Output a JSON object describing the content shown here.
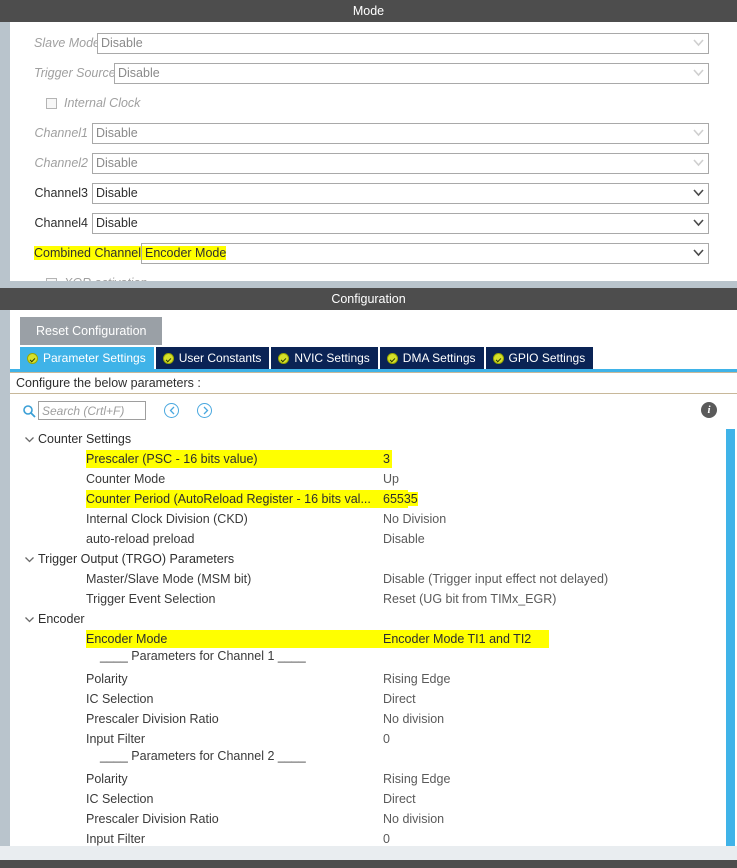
{
  "mode": {
    "title": "Mode",
    "rows": [
      {
        "label": "Slave Mode",
        "value": "Disable",
        "enabled": false,
        "highlight": false,
        "type": "combo"
      },
      {
        "label": "Trigger Source",
        "value": "Disable",
        "enabled": false,
        "highlight": false,
        "type": "combo"
      },
      {
        "label": "Internal Clock",
        "value": "",
        "enabled": false,
        "highlight": false,
        "type": "checkbox",
        "checked": false
      },
      {
        "label": "Channel1",
        "value": "Disable",
        "enabled": false,
        "highlight": false,
        "type": "combo"
      },
      {
        "label": "Channel2",
        "value": "Disable",
        "enabled": false,
        "highlight": false,
        "type": "combo"
      },
      {
        "label": "Channel3",
        "value": "Disable",
        "enabled": true,
        "highlight": false,
        "type": "combo"
      },
      {
        "label": "Channel4",
        "value": "Disable",
        "enabled": true,
        "highlight": false,
        "type": "combo"
      },
      {
        "label": "Combined Channels",
        "value": "Encoder Mode",
        "enabled": true,
        "highlight": true,
        "type": "combo"
      },
      {
        "label": "XOR activation",
        "value": "",
        "enabled": false,
        "highlight": false,
        "type": "checkbox",
        "checked": false
      }
    ]
  },
  "configuration": {
    "title": "Configuration",
    "reset_button": "Reset Configuration",
    "tabs": [
      {
        "label": "Parameter Settings",
        "active": true,
        "icon": "check-circle-icon"
      },
      {
        "label": "User Constants",
        "active": false,
        "icon": "check-circle-icon"
      },
      {
        "label": "NVIC Settings",
        "active": false,
        "icon": "check-circle-icon"
      },
      {
        "label": "DMA Settings",
        "active": false,
        "icon": "check-circle-icon"
      },
      {
        "label": "GPIO Settings",
        "active": false,
        "icon": "check-circle-icon"
      }
    ],
    "configure_note": "Configure the below parameters :",
    "search": {
      "placeholder": "Search (Crtl+F)",
      "value": ""
    },
    "info_glyph": "i",
    "groups": [
      {
        "name": "Counter Settings",
        "expanded": true,
        "rows": [
          {
            "name": "Prescaler (PSC - 16 bits value)",
            "value": "3",
            "highlight": true,
            "hlwidth": "w1"
          },
          {
            "name": "Counter Mode",
            "value": "Up",
            "highlight": false,
            "hlwidth": ""
          },
          {
            "name": "Counter Period (AutoReload Register - 16 bits val...",
            "value": "65535",
            "highlight": true,
            "hlwidth": "w2"
          },
          {
            "name": "Internal Clock Division (CKD)",
            "value": "No Division",
            "highlight": false,
            "hlwidth": ""
          },
          {
            "name": "auto-reload preload",
            "value": "Disable",
            "highlight": false,
            "hlwidth": ""
          }
        ]
      },
      {
        "name": "Trigger Output (TRGO) Parameters",
        "expanded": true,
        "rows": [
          {
            "name": "Master/Slave Mode (MSM bit)",
            "value": "Disable (Trigger input effect not delayed)",
            "highlight": false,
            "hlwidth": ""
          },
          {
            "name": "Trigger Event Selection",
            "value": "Reset (UG bit from TIMx_EGR)",
            "highlight": false,
            "hlwidth": ""
          }
        ]
      },
      {
        "name": "Encoder",
        "expanded": true,
        "rows": [
          {
            "name": "Encoder Mode",
            "value": "Encoder Mode TI1 and TI2",
            "highlight": true,
            "hlwidth": "w3"
          }
        ],
        "separator_1": "____ Parameters for Channel 1 ____",
        "ch1": [
          {
            "name": "Polarity",
            "value": "Rising Edge"
          },
          {
            "name": "IC Selection",
            "value": "Direct"
          },
          {
            "name": "Prescaler Division Ratio",
            "value": "No division"
          },
          {
            "name": "Input Filter",
            "value": "0"
          }
        ],
        "separator_2": "____ Parameters for Channel 2 ____",
        "ch2": [
          {
            "name": "Polarity",
            "value": "Rising Edge"
          },
          {
            "name": "IC Selection",
            "value": "Direct"
          },
          {
            "name": "Prescaler Division Ratio",
            "value": "No division"
          },
          {
            "name": "Input Filter",
            "value": "0"
          }
        ]
      }
    ]
  },
  "colors": {
    "header_bar": "#4d4d4d",
    "panel_bg": "#b9c4cc",
    "tab_active": "#3fb3e8",
    "tab_inactive": "#0a2355",
    "highlight": "#ffff00",
    "scrollbar": "#3fb3e8"
  }
}
